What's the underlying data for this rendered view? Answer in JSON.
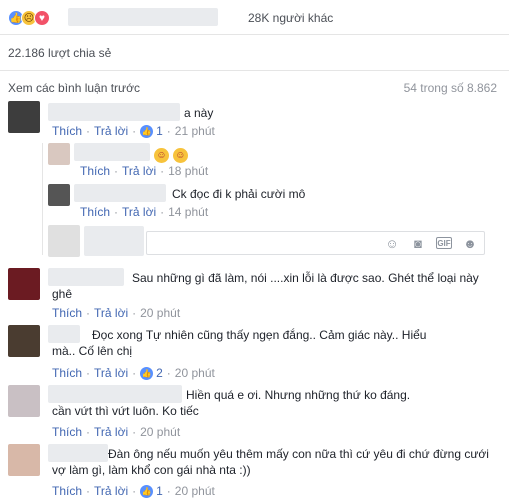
{
  "reactions": {
    "icons": [
      "like-icon",
      "sad-icon",
      "love-icon"
    ],
    "others_text": "28K người khác"
  },
  "shares": "22.186 lượt chia sẻ",
  "comments_header": {
    "previous_link": "Xem các bình luận trước",
    "count": "54 trong số 8.862"
  },
  "actions": {
    "like": "Thích",
    "reply": "Trả lời",
    "sep": "·"
  },
  "comments": [
    {
      "text": "a này",
      "likes": "1",
      "time": "21 phút"
    },
    {
      "text": "Sau những gì đã làm, nói ....xin lỗi là được sao. Ghét thể loại này ghê",
      "time": "20 phút"
    },
    {
      "text": "Đọc xong Tự nhiên cũng thấy ngẹn đắng.. Cảm giác này.. Hiểu mà.. Cố lên chị",
      "likes": "2",
      "time": "20 phút"
    },
    {
      "text": "Hiền quá e ơi. Nhưng những thứ ko đáng. cần vứt thì vứt luôn. Ko tiếc",
      "time": "20 phút"
    },
    {
      "text": "Đàn ông nếu muốn yêu thêm mấy con nữa thì cứ yêu đi chứ đừng cưới vợ làm gì, làm khổ con gái nhà nta :))",
      "likes": "1",
      "time": "20 phút"
    }
  ],
  "replies": [
    {
      "emoji": "😊😊",
      "time": "18 phút"
    },
    {
      "text": "Ck đọc đi k phải cười mô",
      "time": "14 phút"
    }
  ],
  "reply_box": {
    "icons": [
      "emoji-icon",
      "camera-icon",
      "gif-icon",
      "sticker-icon"
    ]
  }
}
